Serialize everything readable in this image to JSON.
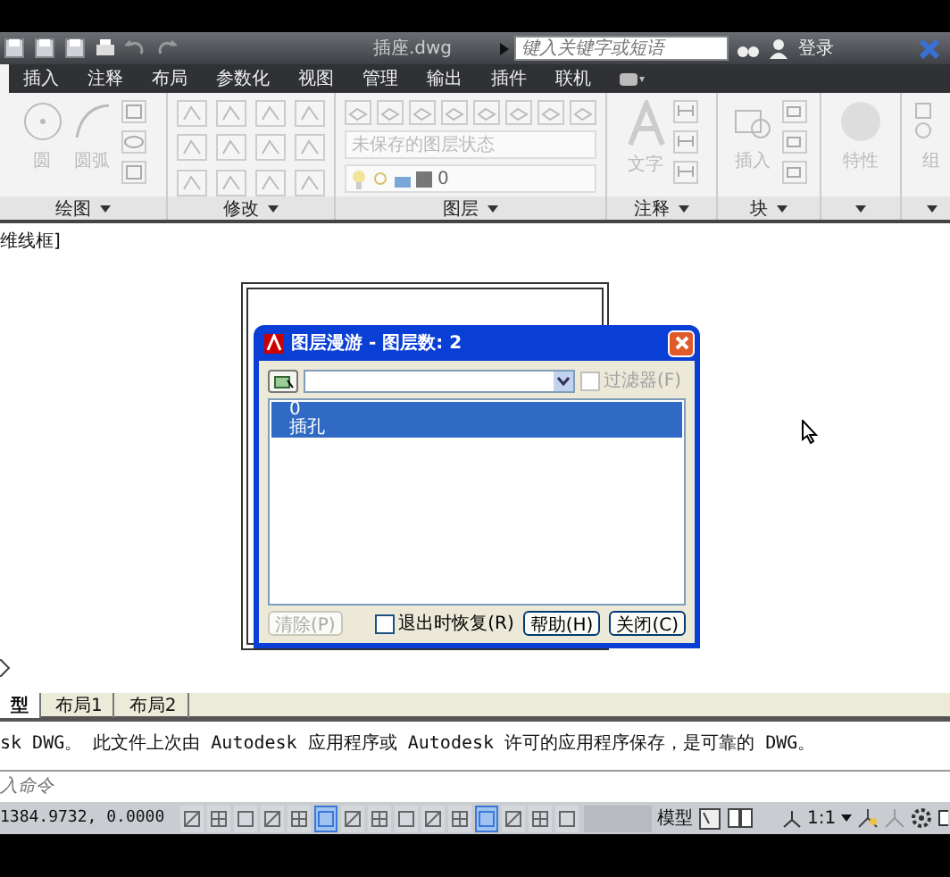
{
  "title_bar": {
    "file_name": "插座.dwg",
    "search": {
      "placeholder": "键入关键字或短语"
    },
    "sign_in": "登录"
  },
  "ribbon": {
    "tabs": [
      "插入",
      "注释",
      "布局",
      "参数化",
      "视图",
      "管理",
      "输出",
      "插件",
      "联机"
    ],
    "panels": [
      {
        "kind": "draw",
        "title": "绘图",
        "tools": [
          "圆",
          "圆弧"
        ]
      },
      {
        "kind": "modify",
        "title": "修改"
      },
      {
        "kind": "layer",
        "title": "图层",
        "layer_state": "未保存的图层状态",
        "current_layer": "0"
      },
      {
        "kind": "annotate",
        "title": "注释",
        "tools": [
          "文字"
        ]
      },
      {
        "kind": "block",
        "title": "块",
        "tools": [
          "插入"
        ]
      },
      {
        "kind": "properties",
        "tools": [
          "特性"
        ]
      },
      {
        "kind": "group",
        "tools": [
          "组"
        ]
      }
    ]
  },
  "drawing": {
    "view_label": "维线框]"
  },
  "dialog": {
    "title": "图层漫游 - 图层数: 2",
    "filter": {
      "label": "过滤器(F)",
      "checked": false,
      "disabled": true
    },
    "layers": [
      {
        "name": "0",
        "selected": true
      },
      {
        "name": "插孔",
        "selected": true
      }
    ],
    "clear_button": {
      "label": "清除(P)",
      "disabled": true
    },
    "restore_on_exit": {
      "label": "退出时恢复(R)",
      "checked": false
    },
    "buttons": [
      "帮助(H)",
      "关闭(C)"
    ]
  },
  "layout_tabs": [
    {
      "label": "型",
      "selected": true
    },
    {
      "label": "布局1",
      "selected": false
    },
    {
      "label": "布局2",
      "selected": false
    }
  ],
  "command_history": "sk DWG。  此文件上次由 Autodesk 应用程序或 Autodesk 许可的应用程序保存，是可靠的 DWG。",
  "command_line": {
    "placeholder": "入命令"
  },
  "status_bar": {
    "coordinates": "1384.9732, 0.0000",
    "toggles": [
      {
        "on": false
      },
      {
        "on": false
      },
      {
        "on": false
      },
      {
        "on": false
      },
      {
        "on": false
      },
      {
        "on": true
      },
      {
        "on": false
      },
      {
        "on": false
      },
      {
        "on": false
      },
      {
        "on": false
      },
      {
        "on": false
      },
      {
        "on": true
      },
      {
        "on": false
      },
      {
        "on": false
      },
      {
        "on": false
      }
    ],
    "space": "模型",
    "scale": "1:1"
  }
}
